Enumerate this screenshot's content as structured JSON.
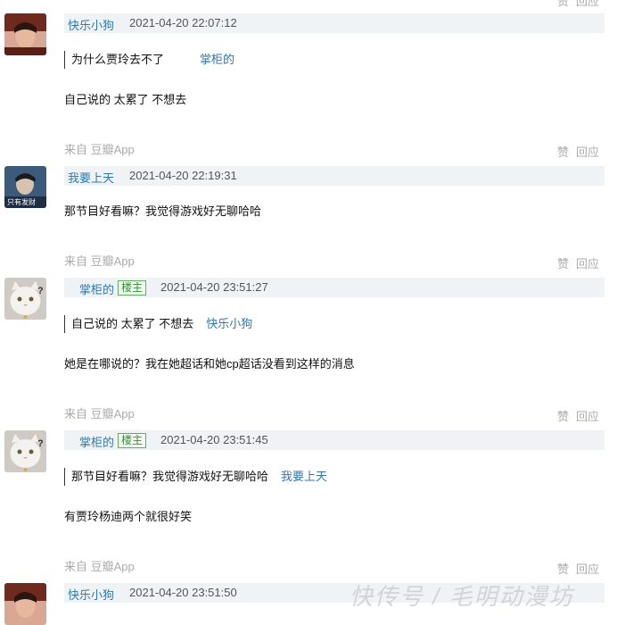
{
  "top_actions": [
    "赞",
    "回应"
  ],
  "comments": [
    {
      "avatar": "avatar-man-red",
      "user": "快乐小狗",
      "badge": "",
      "time": "2021-04-20 22:07:12",
      "quote": {
        "text": "为什么贾玲去不了",
        "author": "掌柜的"
      },
      "text": "自己说的 太累了 不想去",
      "source": "来自 豆瓣App",
      "actions": [
        "赞",
        "回应"
      ]
    },
    {
      "avatar": "avatar-man-blue",
      "avatar_caption": "只有发财",
      "user": "我要上天",
      "badge": "",
      "time": "2021-04-20 22:19:31",
      "text": "那节目好看嘛？我觉得游戏好无聊哈哈",
      "source": "来自 豆瓣App",
      "actions": [
        "赞",
        "回应"
      ]
    },
    {
      "avatar": "avatar-cat",
      "user": "掌柜的",
      "badge": "楼主",
      "time": "2021-04-20 23:51:27",
      "quote": {
        "text": "自己说的 太累了 不想去",
        "author": "快乐小狗"
      },
      "text": "她是在哪说的？我在她超话和她cp超话没看到这样的消息",
      "source": "来自 豆瓣App",
      "actions": [
        "赞",
        "回应"
      ]
    },
    {
      "avatar": "avatar-cat",
      "user": "掌柜的",
      "badge": "楼主",
      "time": "2021-04-20 23:51:45",
      "quote": {
        "text": "那节目好看嘛？我觉得游戏好无聊哈哈",
        "author": "我要上天"
      },
      "text": "有贾玲杨迪两个就很好笑",
      "source": "来自 豆瓣App",
      "actions": [
        "赞",
        "回应"
      ]
    },
    {
      "avatar": "avatar-man-red",
      "user": "快乐小狗",
      "badge": "",
      "time": "2021-04-20 23:51:50"
    }
  ],
  "watermark": "快传号 / 毛明动漫坊"
}
